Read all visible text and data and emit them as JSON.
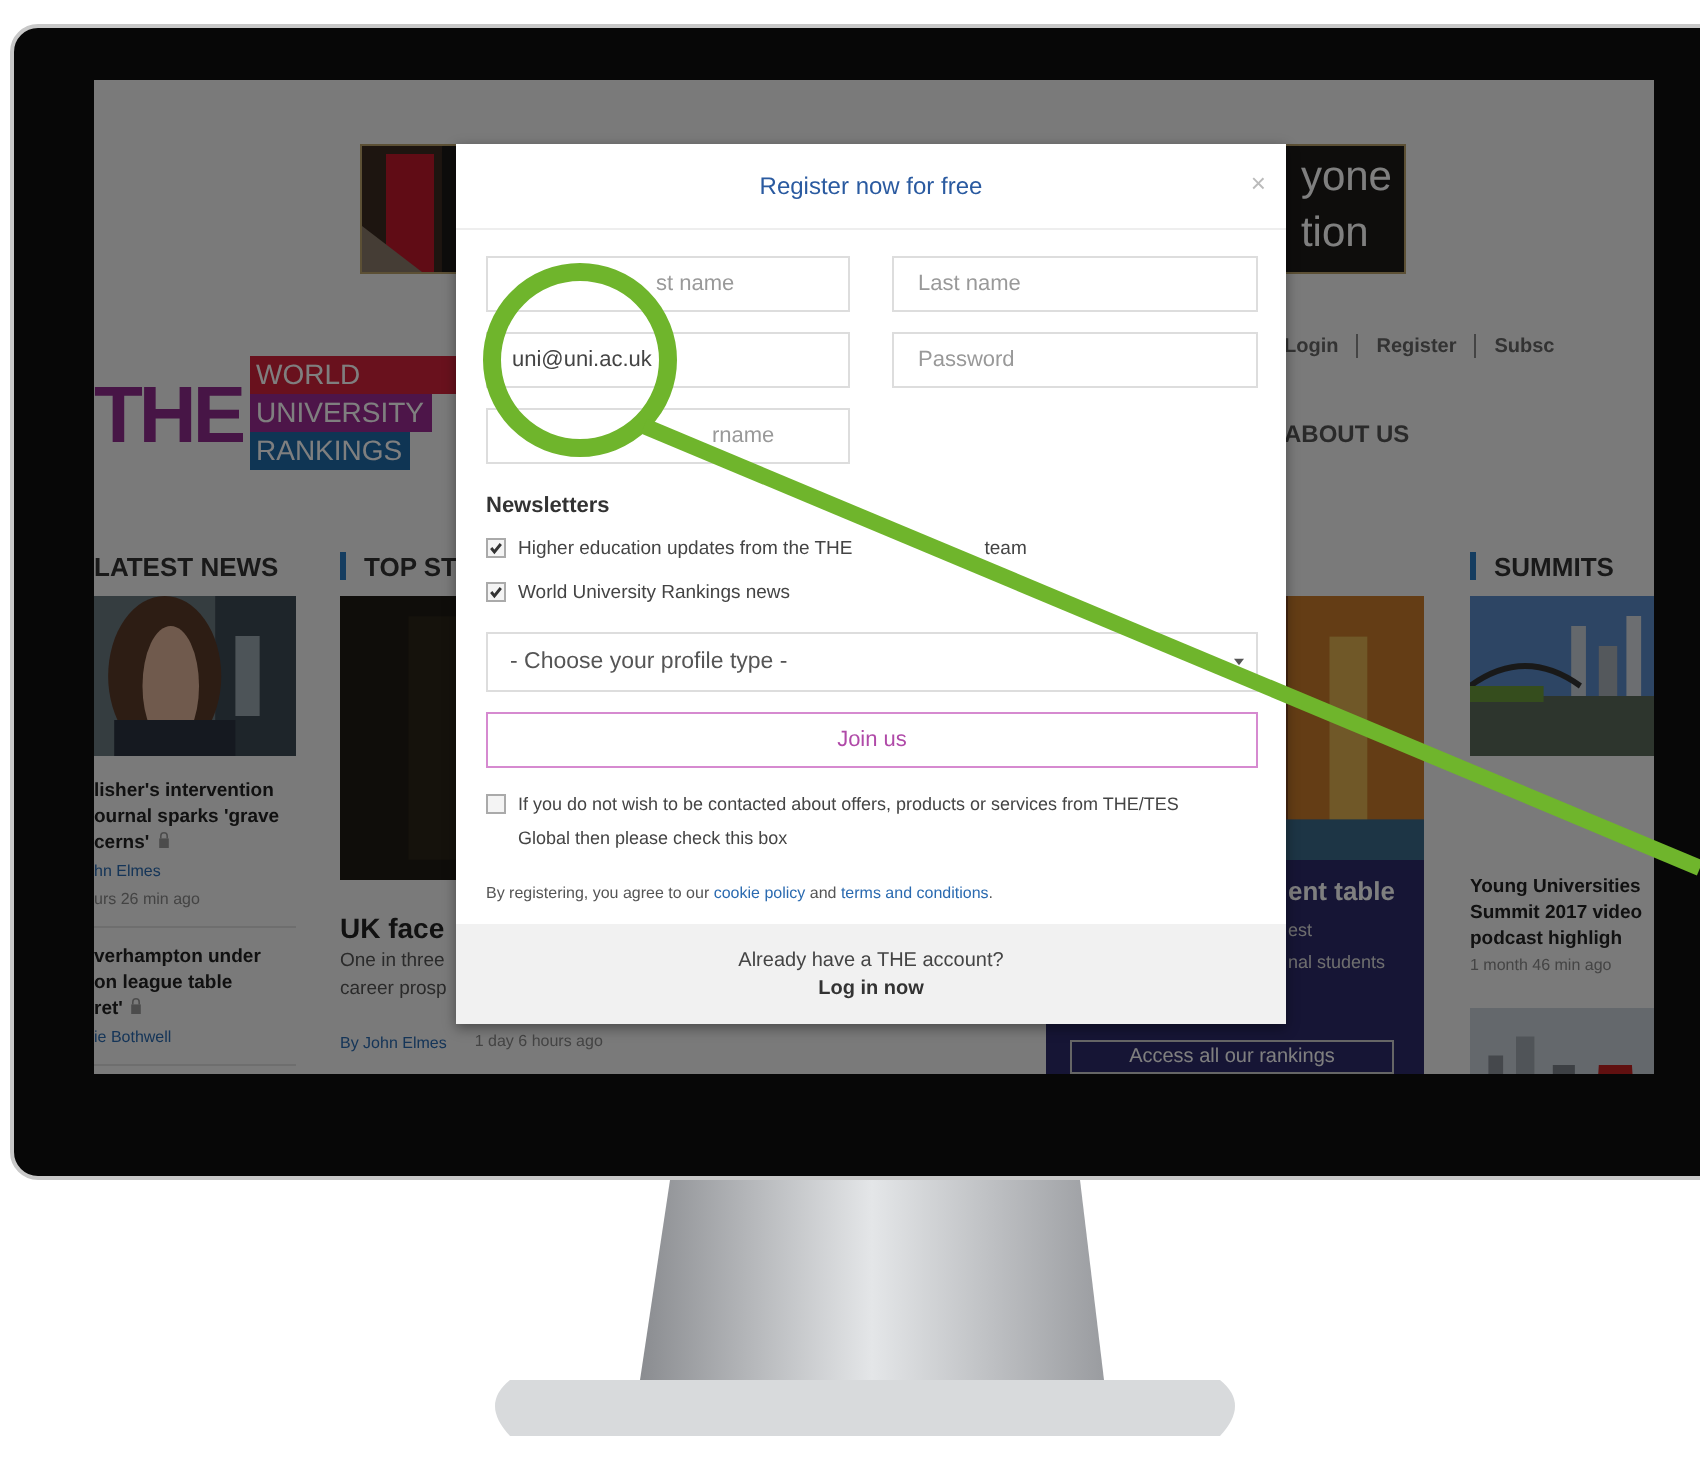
{
  "banner": {
    "lines": [
      "yone",
      "tion"
    ]
  },
  "top_links": [
    "Login",
    "Register",
    "Subsc"
  ],
  "logo": {
    "mark": "THE",
    "lines": [
      "WORLD",
      "UNIVERSITY",
      "RANKINGS"
    ]
  },
  "nav": [
    "ABOUT US"
  ],
  "latest_news": {
    "heading": "LATEST NEWS",
    "items": [
      {
        "lines": [
          "lisher's intervention",
          "ournal sparks 'grave",
          "cerns'"
        ],
        "locked": true,
        "byline": "hn Elmes",
        "time": "urs 26 min ago"
      },
      {
        "lines": [
          "verhampton under",
          "on league table",
          "ret'"
        ],
        "locked": true,
        "byline": "ie Bothwell"
      }
    ]
  },
  "top_stories": {
    "heading": "TOP ST",
    "title": "UK face",
    "summary_lines": [
      "One in three",
      "career prosp"
    ],
    "byline": "By John Elmes",
    "time": "1 day 6 hours ago"
  },
  "rankings_promo": {
    "title": "ent table",
    "lines": [
      "est",
      "nal students"
    ],
    "button": "Access all our rankings"
  },
  "summits": {
    "heading": "SUMMITS",
    "title_lines": [
      "Young Universities",
      "Summit 2017 video",
      "podcast highligh"
    ],
    "time": "1 month 46 min ago"
  },
  "modal": {
    "title": "Register now for free",
    "close": "×",
    "fields": [
      {
        "placeholder": "st name"
      },
      {
        "placeholder": "Last name"
      },
      {
        "value": "uni@uni.ac.uk"
      },
      {
        "placeholder": "Password"
      },
      {
        "placeholder": "rname"
      }
    ],
    "newsletters_heading": "Newsletters",
    "newsletters": [
      {
        "label_parts": [
          "Higher education updates from the THE",
          "team"
        ],
        "checked": true
      },
      {
        "label_parts": [
          "World University Rankings news"
        ],
        "checked": true
      }
    ],
    "profile_select": {
      "placeholder": "- Choose your profile type -"
    },
    "join_button": "Join us",
    "opt_out": {
      "label": "If you do not wish to be contacted about offers, products or services from THE/TES Global then please check this box",
      "checked": false
    },
    "terms": {
      "text": "By registering, you agree to our ",
      "cookie_link": "cookie policy",
      "middle": " and ",
      "terms_link": "terms and conditions",
      "end": "."
    },
    "footer": {
      "question": "Already have a THE account?",
      "login_link": "Log in now"
    }
  }
}
